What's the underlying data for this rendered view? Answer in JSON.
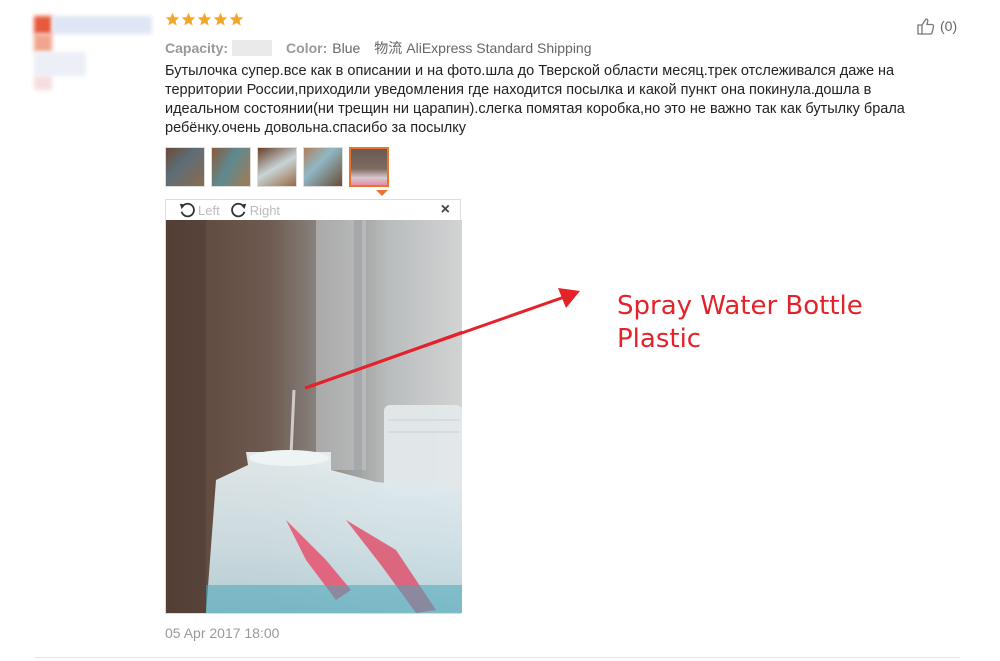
{
  "review": {
    "rating_stars": 5,
    "capacity_label": "Capacity:",
    "color_label": "Color:",
    "color_value": "Blue",
    "shipping_prefix": "物流",
    "shipping_value": "AliExpress Standard Shipping",
    "helpful_count": "(0)",
    "text": "Бутылочка супер.все как в описании и на фото.шла до Тверской области месяц.трек отслеживался даже на территории России,приходили уведомления где находится посылка и какой пункт она покинула.дошла в идеальном состоянии(ни трещин ни царапин).слегка помятая коробка,но это не важно так как бутылку брала ребёнку.очень довольна.спасибо за посылку",
    "date": "05 Apr 2017 18:00"
  },
  "viewer": {
    "rotate_left_label": "Left",
    "rotate_right_label": "Right",
    "close_symbol": "×",
    "active_thumbnail_index": 4
  },
  "annotation": {
    "line1": "Spray Water Bottle",
    "line2": "Plastic"
  },
  "colors": {
    "star": "#f5a623",
    "accent_orange": "#e8742f",
    "annotation_red": "#e3222a"
  },
  "icons": [
    "star-icon",
    "thumbs-up-icon",
    "rotate-left-icon",
    "rotate-right-icon",
    "close-icon"
  ]
}
